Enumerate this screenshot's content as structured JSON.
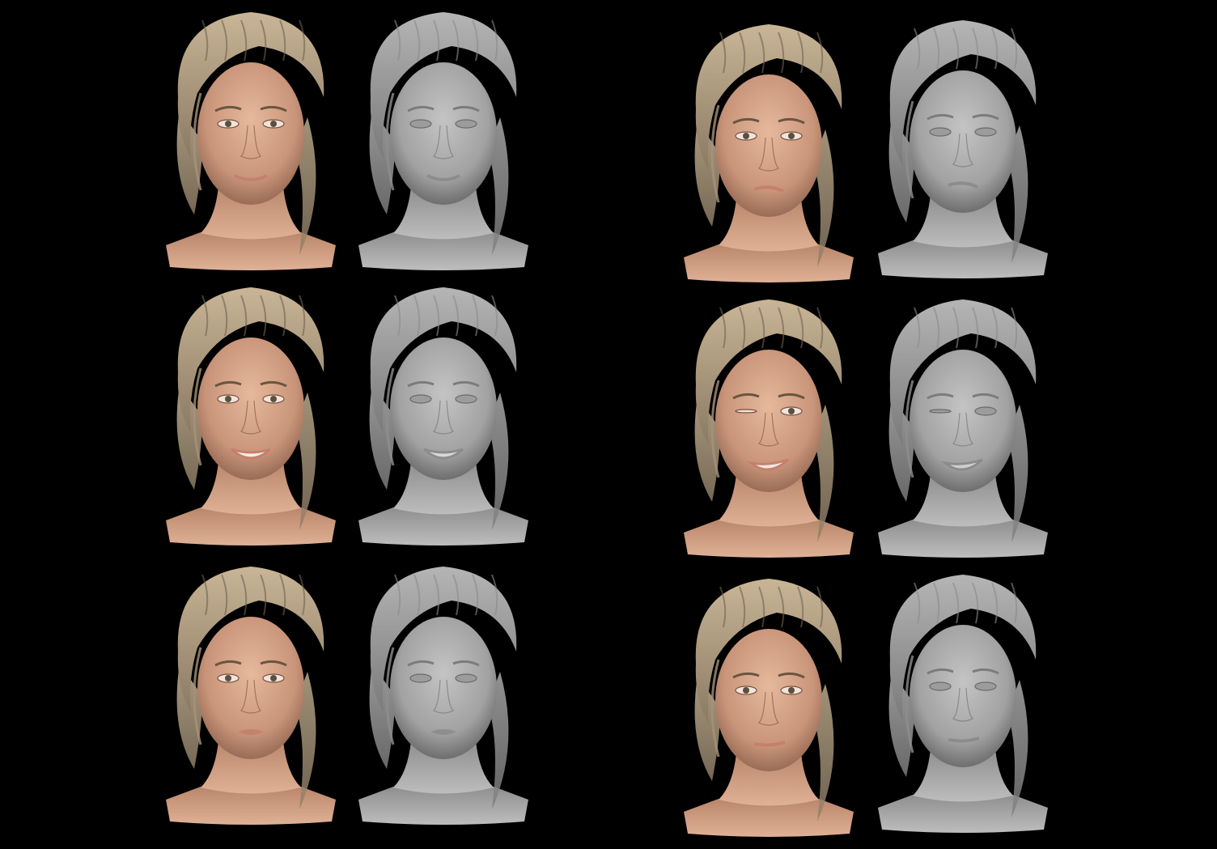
{
  "colors": {
    "background": "#000000",
    "skin": "#d9a98e",
    "skin_shadow": "#b07f66",
    "hair": "#b7a285",
    "hair_dark": "#6f6150",
    "clay": "#a9a9a9",
    "clay_shadow": "#6e6e6e",
    "clay_hair": "#9a9a9a",
    "lip": "#c4806e",
    "eye": "#5a5040"
  },
  "renders": [
    {
      "id": "left-row1-textured",
      "shading": "textured",
      "expression": "soft-smile"
    },
    {
      "id": "left-row1-clay",
      "shading": "clay",
      "expression": "soft-smile"
    },
    {
      "id": "left-row2-textured",
      "shading": "textured",
      "expression": "toothy-smile"
    },
    {
      "id": "left-row2-clay",
      "shading": "clay",
      "expression": "toothy-smile"
    },
    {
      "id": "left-row3-textured",
      "shading": "textured",
      "expression": "pout"
    },
    {
      "id": "left-row3-clay",
      "shading": "clay",
      "expression": "pout"
    },
    {
      "id": "right-row1-textured",
      "shading": "textured",
      "expression": "lip-bite-skeptical"
    },
    {
      "id": "right-row1-clay",
      "shading": "clay",
      "expression": "lip-bite-skeptical"
    },
    {
      "id": "right-row2-textured",
      "shading": "textured",
      "expression": "wink-tongue"
    },
    {
      "id": "right-row2-clay",
      "shading": "clay",
      "expression": "wink-tongue"
    },
    {
      "id": "right-row3-textured",
      "shading": "textured",
      "expression": "neutral-smirk"
    },
    {
      "id": "right-row3-clay",
      "shading": "clay",
      "expression": "neutral-smirk"
    }
  ]
}
